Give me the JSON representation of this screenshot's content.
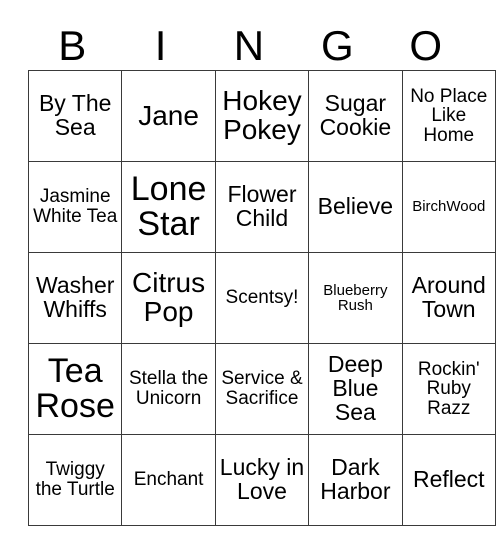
{
  "card": {
    "headers": [
      "B",
      "I",
      "N",
      "G",
      "O"
    ],
    "rows": [
      [
        {
          "text": "By The Sea",
          "size": "md"
        },
        {
          "text": "Jane",
          "size": "lg"
        },
        {
          "text": "Hokey Pokey",
          "size": "lg"
        },
        {
          "text": "Sugar Cookie",
          "size": "md"
        },
        {
          "text": "No Place Like Home",
          "size": "sm"
        }
      ],
      [
        {
          "text": "Jasmine White Tea",
          "size": "sm"
        },
        {
          "text": "Lone Star",
          "size": "xl"
        },
        {
          "text": "Flower Child",
          "size": "md"
        },
        {
          "text": "Believe",
          "size": "md"
        },
        {
          "text": "BirchWood",
          "size": "xs"
        }
      ],
      [
        {
          "text": "Washer Whiffs",
          "size": "md"
        },
        {
          "text": "Citrus Pop",
          "size": "lg"
        },
        {
          "text": "Scentsy!",
          "size": "sm"
        },
        {
          "text": "Blueberry Rush",
          "size": "xs"
        },
        {
          "text": "Around Town",
          "size": "md"
        }
      ],
      [
        {
          "text": "Tea Rose",
          "size": "xl"
        },
        {
          "text": "Stella the Unicorn",
          "size": "sm"
        },
        {
          "text": "Service & Sacrifice",
          "size": "sm"
        },
        {
          "text": "Deep Blue Sea",
          "size": "md"
        },
        {
          "text": "Rockin' Ruby Razz",
          "size": "sm"
        }
      ],
      [
        {
          "text": "Twiggy the Turtle",
          "size": "sm"
        },
        {
          "text": "Enchant",
          "size": "sm"
        },
        {
          "text": "Lucky in Love",
          "size": "md"
        },
        {
          "text": "Dark Harbor",
          "size": "md"
        },
        {
          "text": "Reflect",
          "size": "md"
        }
      ]
    ],
    "colors": {
      "background": "#ffffff",
      "text": "#000000",
      "border": "#3a3a3a"
    }
  }
}
